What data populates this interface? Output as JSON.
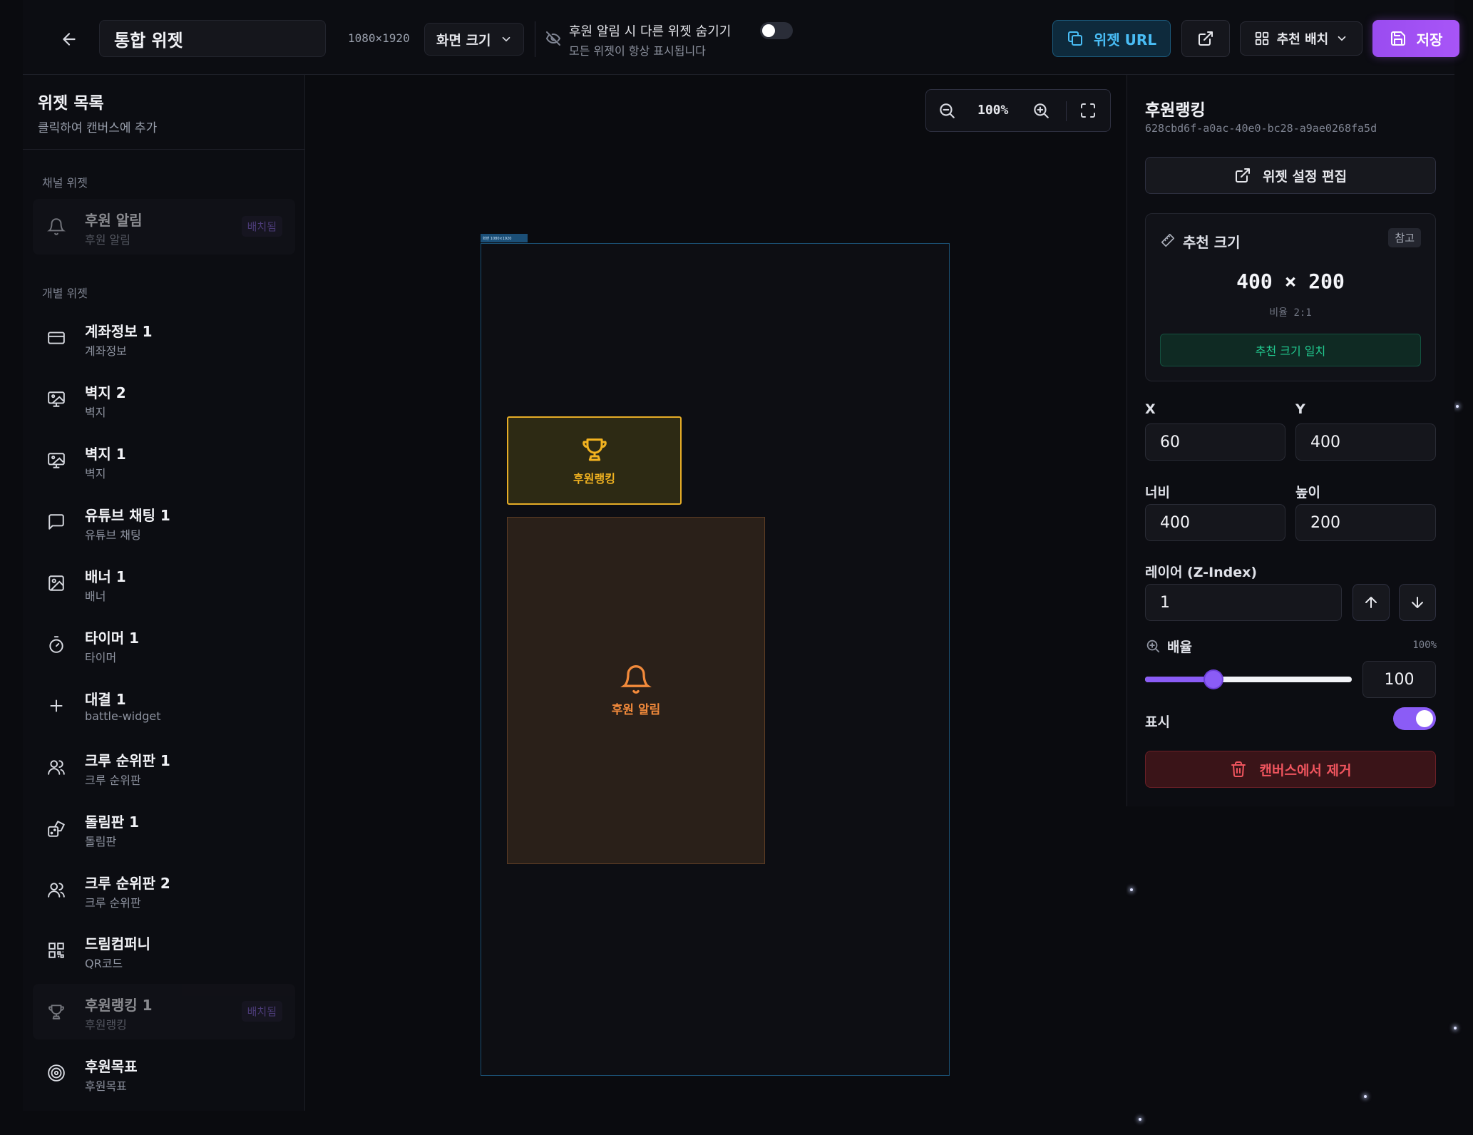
{
  "topbar": {
    "title_value": "통합 위젯",
    "resolution": "1080×1920",
    "size_dropdown": "화면 크기",
    "hide_toggle_title": "후원 알림 시 다른 위젯 숨기기",
    "hide_toggle_sub": "모든 위젯이 항상 표시됩니다",
    "hide_toggle_on": false,
    "url_button": "위젯 URL",
    "layout_button": "추천 배치",
    "save_button": "저장"
  },
  "sidebar": {
    "title": "위젯 목록",
    "subtitle": "클릭하여 캔버스에 추가",
    "channel_section": "채널 위젯",
    "individual_section": "개별 위젯",
    "placed_badge": "배치됨",
    "channel_items": [
      {
        "name": "후원 알림",
        "type": "후원 알림",
        "icon": "bell-icon",
        "placed": true
      }
    ],
    "items": [
      {
        "name": "계좌정보 1",
        "type": "계좌정보",
        "icon": "credit-card-icon",
        "placed": false
      },
      {
        "name": "벽지 2",
        "type": "벽지",
        "icon": "wallpaper-icon",
        "placed": false
      },
      {
        "name": "벽지 1",
        "type": "벽지",
        "icon": "wallpaper-icon",
        "placed": false
      },
      {
        "name": "유튜브 채팅 1",
        "type": "유튜브 채팅",
        "icon": "chat-icon",
        "placed": false
      },
      {
        "name": "배너 1",
        "type": "배너",
        "icon": "image-icon",
        "placed": false
      },
      {
        "name": "타이머 1",
        "type": "타이머",
        "icon": "timer-icon",
        "placed": false
      },
      {
        "name": "대결 1",
        "type": "battle-widget",
        "icon": "plus-icon",
        "placed": false
      },
      {
        "name": "크루 순위판 1",
        "type": "크루 순위판",
        "icon": "users-icon",
        "placed": false
      },
      {
        "name": "돌림판 1",
        "type": "돌림판",
        "icon": "dice-icon",
        "placed": false
      },
      {
        "name": "크루 순위판 2",
        "type": "크루 순위판",
        "icon": "users-icon",
        "placed": false
      },
      {
        "name": "드림컴퍼니",
        "type": "QR코드",
        "icon": "qr-code-icon",
        "placed": false
      },
      {
        "name": "후원랭킹 1",
        "type": "후원랭킹",
        "icon": "trophy-icon",
        "placed": true
      },
      {
        "name": "후원목표",
        "type": "후원목표",
        "icon": "target-icon",
        "placed": false
      }
    ]
  },
  "canvas": {
    "zoom": "100%",
    "screen_tag": "화면 1080×1920",
    "widgets": [
      {
        "label": "후원랭킹",
        "icon": "trophy-icon",
        "color": "#e6ad27"
      },
      {
        "label": "후원 알림",
        "icon": "bell-icon",
        "color": "#f28a3b"
      }
    ]
  },
  "panel": {
    "title": "후원랭킹",
    "widget_id": "628cbd6f-a0ac-40e0-bc28-a9ae0268fa5d",
    "edit_button": "위젯 설정 편집",
    "recommended_title": "추천 크기",
    "recommended_badge": "참고",
    "recommended_size": "400 × 200",
    "ratio": "비율 2:1",
    "match_text": "추천 크기 일치",
    "x_label": "X",
    "x_value": "60",
    "y_label": "Y",
    "y_value": "400",
    "width_label": "너비",
    "width_value": "400",
    "height_label": "높이",
    "height_value": "200",
    "layer_label": "레이어 (Z-Index)",
    "layer_value": "1",
    "scale_label": "배율",
    "scale_percent": "100%",
    "scale_value": "100",
    "scale_fraction": 0.33,
    "visible_label": "표시",
    "visible_on": true,
    "remove_button": "캔버스에서 제거"
  },
  "colors": {
    "accent": "#8b5cf6",
    "url_accent": "#49bdf5",
    "danger": "#f0555e",
    "success": "#21c98f",
    "ranking": "#e6ad27",
    "alert": "#f28a3b"
  }
}
